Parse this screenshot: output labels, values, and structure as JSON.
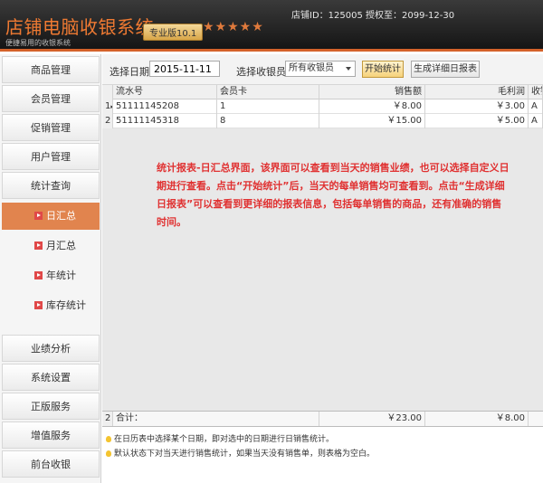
{
  "header": {
    "title": "店铺电脑收银系统",
    "subtitle": "便捷易用的收银系统",
    "version_badge": "专业版10.1",
    "stars": "★★★★★",
    "store_info": "店铺ID：125005 授权至：2099-12-30",
    "accent_color": "#f07a32"
  },
  "sidebar": {
    "items": [
      {
        "label": "商品管理"
      },
      {
        "label": "会员管理"
      },
      {
        "label": "促销管理"
      },
      {
        "label": "用户管理"
      },
      {
        "label": "统计查询"
      },
      {
        "label": "业绩分析"
      },
      {
        "label": "系统设置"
      },
      {
        "label": "正版服务"
      },
      {
        "label": "增值服务"
      },
      {
        "label": "前台收银"
      }
    ],
    "sub_items": [
      {
        "label": "日汇总",
        "active": true
      },
      {
        "label": "月汇总"
      },
      {
        "label": "年统计"
      },
      {
        "label": "库存统计"
      }
    ],
    "active_color": "#e1844e"
  },
  "toolbar": {
    "date_label": "选择日期：",
    "date_value": "2015-11-11",
    "cashier_label": "选择收银员：",
    "cashier_value": "所有收银员",
    "start_button": "开始统计",
    "detail_button": "生成详细日报表"
  },
  "grid": {
    "columns": [
      "流水号",
      "会员卡",
      "销售额",
      "毛利润",
      "收银"
    ],
    "rows": [
      {
        "index": "1",
        "marker": "▸",
        "serial": "51111145208",
        "card": "1",
        "sales": "￥8.00",
        "profit": "￥3.00",
        "cashier": "A"
      },
      {
        "index": "2",
        "marker": "",
        "serial": "51111145318",
        "card": "8",
        "sales": "￥15.00",
        "profit": "￥5.00",
        "cashier": "A"
      }
    ],
    "totals": {
      "index": "2",
      "label": "合计：",
      "sales": "￥23.00",
      "profit": "￥8.00"
    }
  },
  "annotation": "统计报表-日汇总界面，该界面可以查看到当天的销售业绩，也可以选择自定义日期进行查看。点击“开始统计”后，当天的每单销售均可查看到。点击“生成详细日报表”可以查看到更详细的报表信息，包括每单销售的商品，还有准确的销售时间。",
  "tips": [
    "在日历表中选择某个日期，即对选中的日期进行日销售统计。",
    "默认状态下对当天进行销售统计，如果当天没有销售单，则表格为空白。"
  ]
}
